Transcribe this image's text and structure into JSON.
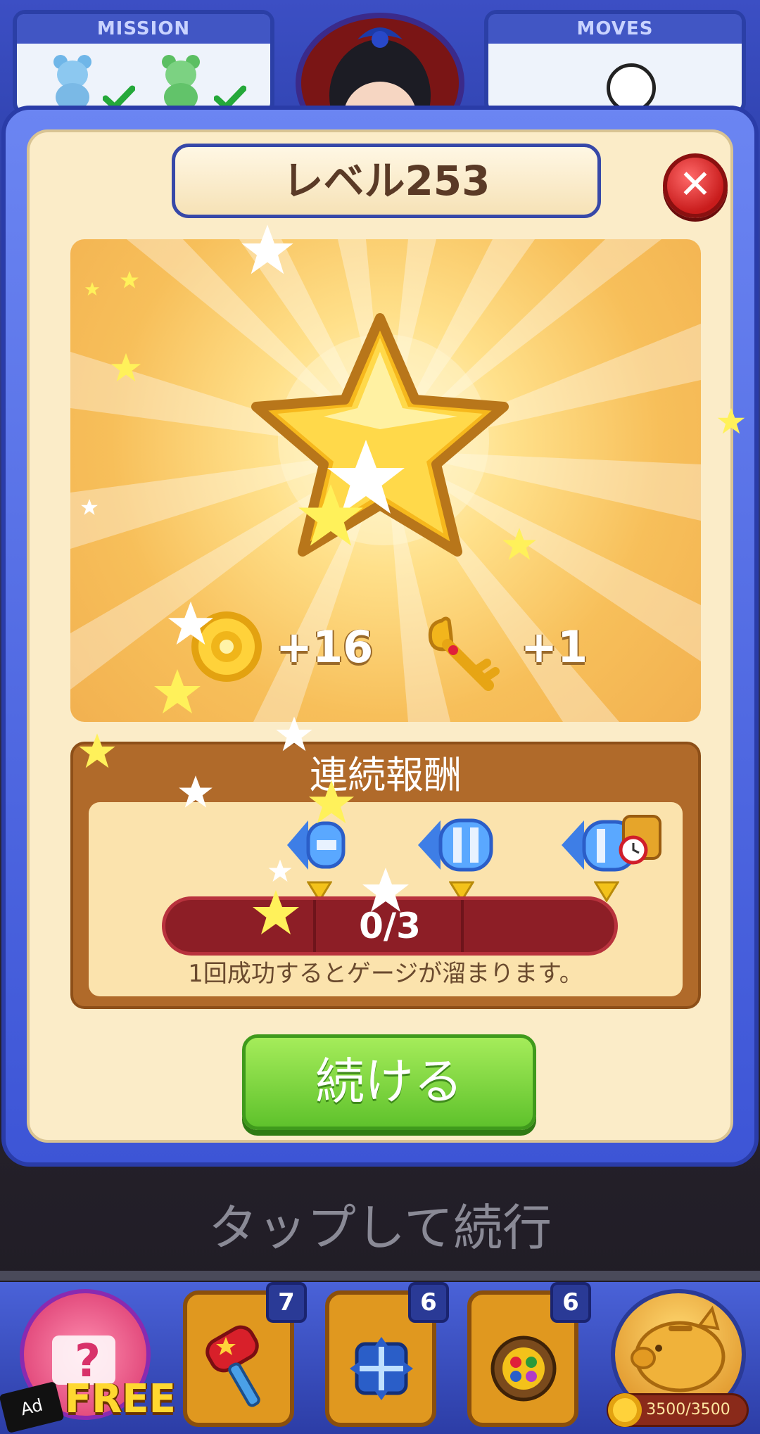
{
  "hud": {
    "mission_label": "MISSION",
    "moves_label": "MOVES"
  },
  "dialog": {
    "title": "レベル253",
    "close_icon": "close-icon",
    "rewards": [
      {
        "icon": "coin-icon",
        "value": "+16"
      },
      {
        "icon": "key-icon",
        "value": "+1"
      }
    ],
    "streak": {
      "title": "連続報酬",
      "progress_text": "0/3",
      "progress_current": 0,
      "progress_total": 3,
      "hint": "1回成功するとゲージが溜まります。",
      "boosters": [
        "rocket-booster-icon",
        "double-rocket-booster-icon",
        "rocket-bomb-booster-icon"
      ]
    },
    "continue_label": "続ける"
  },
  "background": {
    "tap_hint": "タップして続行"
  },
  "bottom_bar": {
    "free_label": "FREE",
    "ad_label": "Ad",
    "boosters": [
      {
        "icon": "hammer-icon",
        "count": "7"
      },
      {
        "icon": "shuffle-icon",
        "count": "6"
      },
      {
        "icon": "color-bomb-icon",
        "count": "6"
      }
    ],
    "piggy_bank": "3500/3500"
  },
  "colors": {
    "frame_blue": "#3d55d6",
    "panel_cream": "#fbecc8",
    "reward_gold": "#f7bf5a",
    "streak_brown": "#b06a2a",
    "progress_red": "#8d1e26",
    "continue_green": "#5fc22c"
  }
}
